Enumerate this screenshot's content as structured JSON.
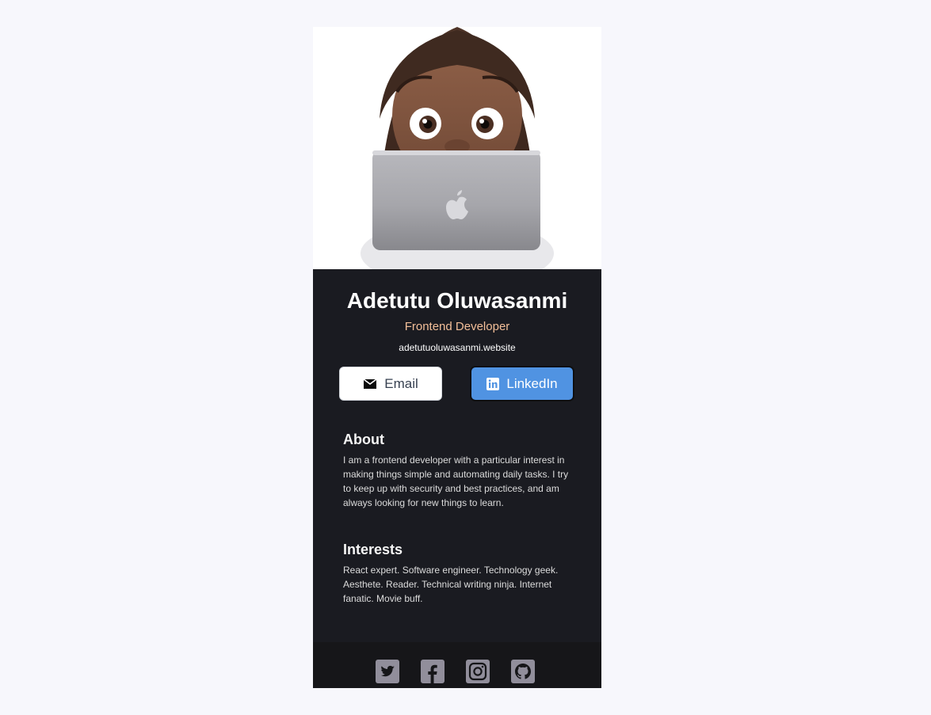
{
  "profile": {
    "name": "Adetutu Oluwasanmi",
    "role": "Frontend Developer",
    "website": "adetutuoluwasanmi.website"
  },
  "actions": {
    "email_label": "Email",
    "linkedin_label": "LinkedIn"
  },
  "about": {
    "title": "About",
    "text": "I am a frontend developer with a particular interest in making things simple and automating daily tasks. I try to keep up with security and best practices, and am always looking for new things to learn."
  },
  "interests": {
    "title": "Interests",
    "text": "React expert. Software engineer. Technology geek. Aesthete. Reader. Technical writing ninja. Internet fanatic. Movie buff."
  },
  "footer": {
    "icons": [
      "twitter-icon",
      "facebook-icon",
      "instagram-icon",
      "github-icon"
    ]
  },
  "colors": {
    "page_bg": "#f7f7fc",
    "card_bg": "#1a1b21",
    "footer_bg": "#161619",
    "accent": "#f3bf99",
    "linkedin_blue": "#5093e2",
    "icon": "#918e9b"
  }
}
